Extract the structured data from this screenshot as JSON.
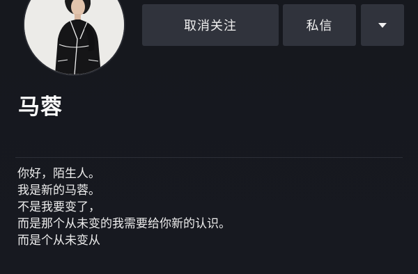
{
  "profile": {
    "name": "马蓉",
    "avatar_icon": "user-avatar-photo"
  },
  "actions": {
    "unfollow_label": "取消关注",
    "message_label": "私信",
    "more_icon": "caret-down-icon"
  },
  "bio": {
    "lines": [
      "你好，陌生人。",
      "我是新的马蓉。",
      "不是我要变了，",
      "而是那个从未变的我需要给你新的认识。",
      "而是个从未变从"
    ]
  },
  "colors": {
    "background": "#171920",
    "button": "#30333c",
    "text": "#f2f2f2"
  }
}
